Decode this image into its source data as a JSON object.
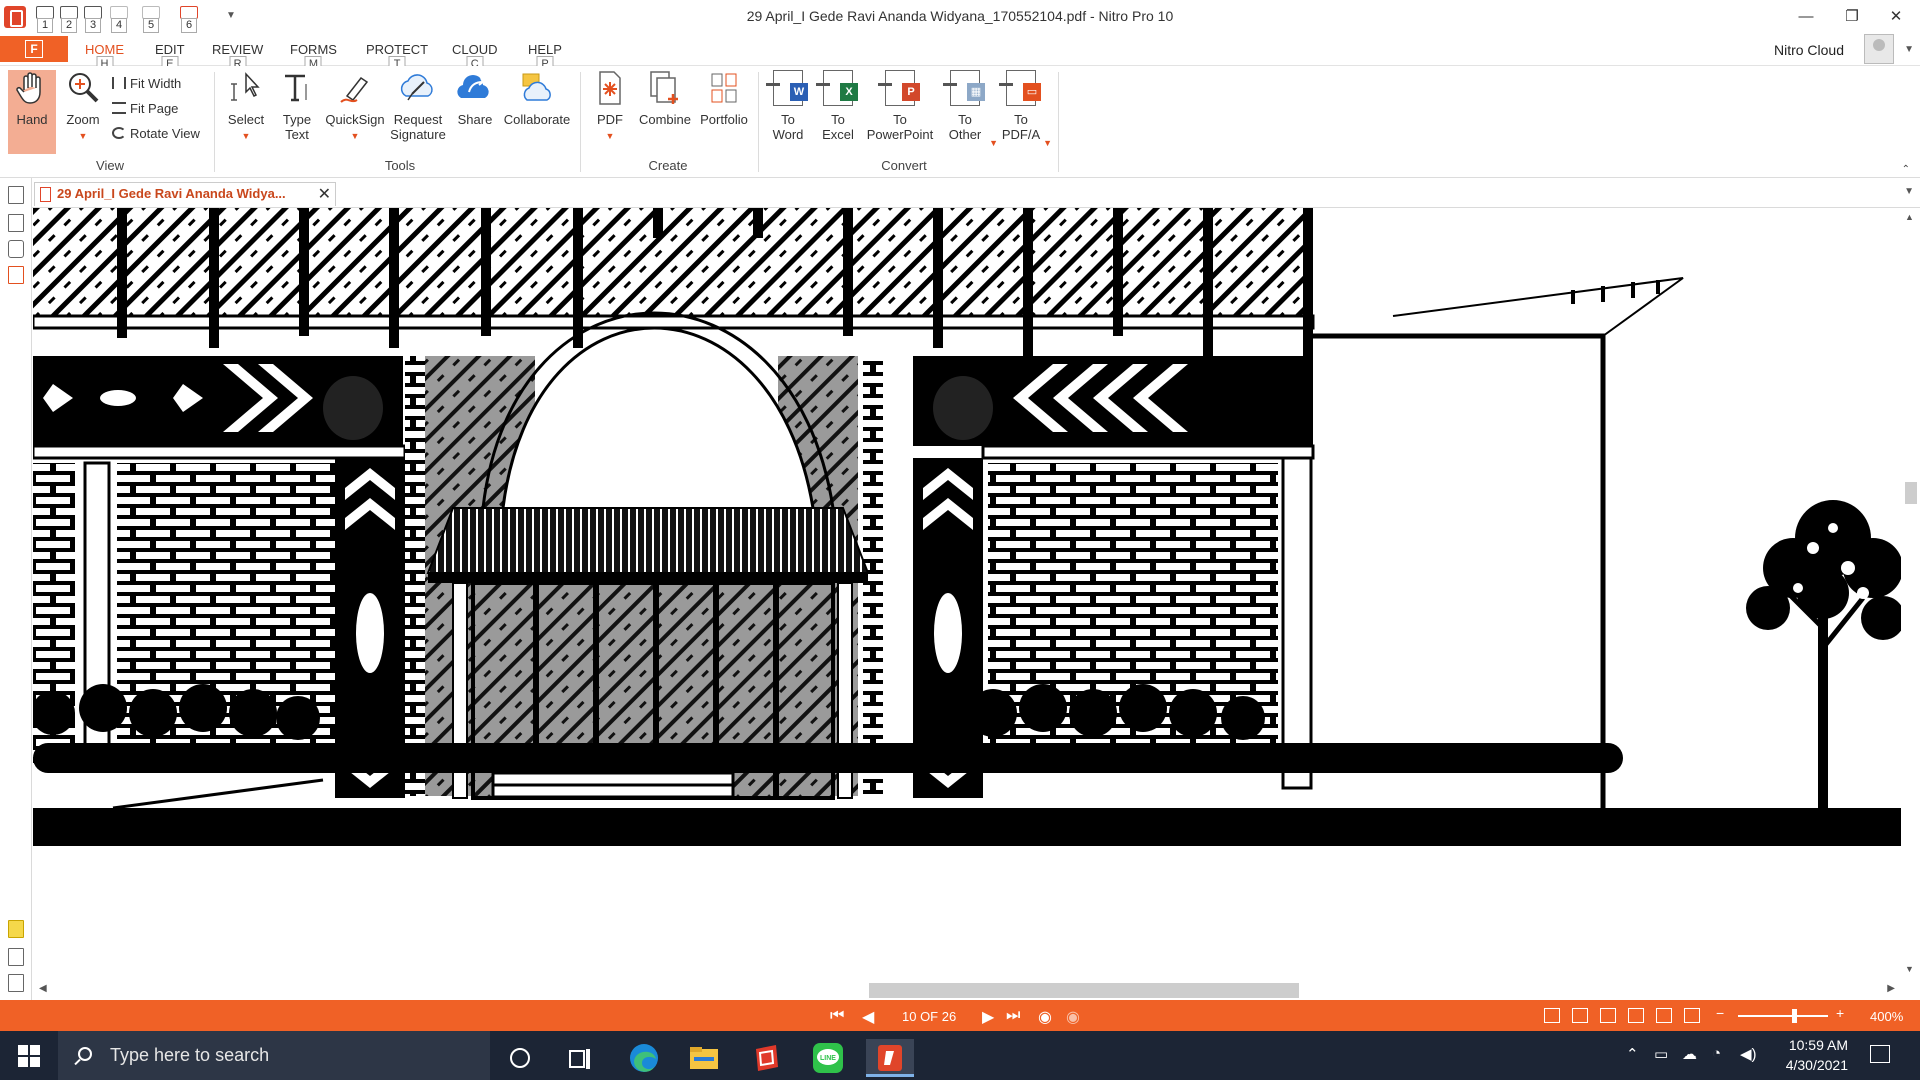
{
  "window": {
    "title": "29 April_I Gede Ravi Ananda Widyana_170552104.pdf - Nitro Pro 10",
    "minimize_icon": "minimize-icon",
    "restore_icon": "restore-icon",
    "close_icon": "close-icon"
  },
  "quick_access": [
    "1",
    "2",
    "3",
    "4",
    "5",
    "6"
  ],
  "ribbon_tabs": {
    "file": "F",
    "tabs": [
      {
        "label": "HOME",
        "key": "H"
      },
      {
        "label": "EDIT",
        "key": "E"
      },
      {
        "label": "REVIEW",
        "key": "R"
      },
      {
        "label": "FORMS",
        "key": "M"
      },
      {
        "label": "PROTECT",
        "key": "T"
      },
      {
        "label": "CLOUD",
        "key": "C"
      },
      {
        "label": "HELP",
        "key": "P"
      }
    ],
    "account": "Nitro Cloud"
  },
  "ribbon": {
    "view": {
      "label": "View",
      "hand": "Hand",
      "zoom": "Zoom",
      "fit_width": "Fit Width",
      "fit_page": "Fit Page",
      "rotate_view": "Rotate View"
    },
    "tools": {
      "label": "Tools",
      "select": "Select",
      "type_text_1": "Type",
      "type_text_2": "Text",
      "quicksign": "QuickSign",
      "request_1": "Request",
      "request_2": "Signature",
      "share": "Share",
      "collaborate": "Collaborate"
    },
    "create": {
      "label": "Create",
      "pdf": "PDF",
      "combine": "Combine",
      "portfolio": "Portfolio"
    },
    "convert": {
      "label": "Convert",
      "to_word_1": "To",
      "to_word_2": "Word",
      "to_excel_1": "To",
      "to_excel_2": "Excel",
      "to_ppt_1": "To",
      "to_ppt_2": "PowerPoint",
      "to_other_1": "To",
      "to_other_2": "Other",
      "to_pdfa_1": "To",
      "to_pdfa_2": "PDF/A"
    }
  },
  "document_tab": {
    "label": "29 April_I Gede Ravi Ananda Widya...",
    "close": "✕"
  },
  "status": {
    "page": "10 OF 26",
    "zoom": "400%",
    "zoom_level_fraction": 0.62
  },
  "taskbar": {
    "search_placeholder": "Type here to search",
    "time": "10:59 AM",
    "date": "4/30/2021"
  },
  "colors": {
    "accent": "#f06126",
    "taskbar": "#1c2535"
  }
}
